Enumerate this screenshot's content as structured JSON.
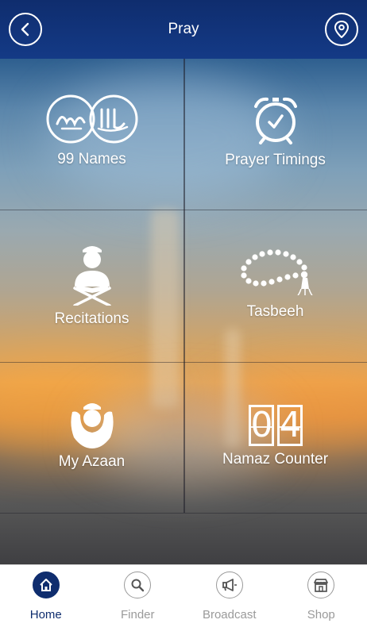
{
  "header": {
    "title": "Pray",
    "back_icon": "chevron-left-icon",
    "location_icon": "location-pin-icon"
  },
  "tiles": [
    {
      "label": "99 Names",
      "icon": "calligraphy-medallions-icon"
    },
    {
      "label": "Prayer Timings",
      "icon": "alarm-clock-icon"
    },
    {
      "label": "Recitations",
      "icon": "quran-reader-icon"
    },
    {
      "label": "Tasbeeh",
      "icon": "prayer-beads-icon"
    },
    {
      "label": "My Azaan",
      "icon": "azaan-caller-icon"
    },
    {
      "label": "Namaz Counter",
      "icon": "flip-counter-icon",
      "counter_digits": [
        "0",
        "4"
      ]
    }
  ],
  "tabbar": {
    "items": [
      {
        "label": "Home",
        "icon": "home-icon",
        "active": true
      },
      {
        "label": "Finder",
        "icon": "search-icon",
        "active": false
      },
      {
        "label": "Broadcast",
        "icon": "megaphone-icon",
        "active": false
      },
      {
        "label": "Shop",
        "icon": "shop-icon",
        "active": false
      }
    ]
  },
  "colors": {
    "header_bg": "#0f2d6e",
    "active_tab": "#0f2d6e",
    "inactive_tab": "#9a9a9a"
  }
}
